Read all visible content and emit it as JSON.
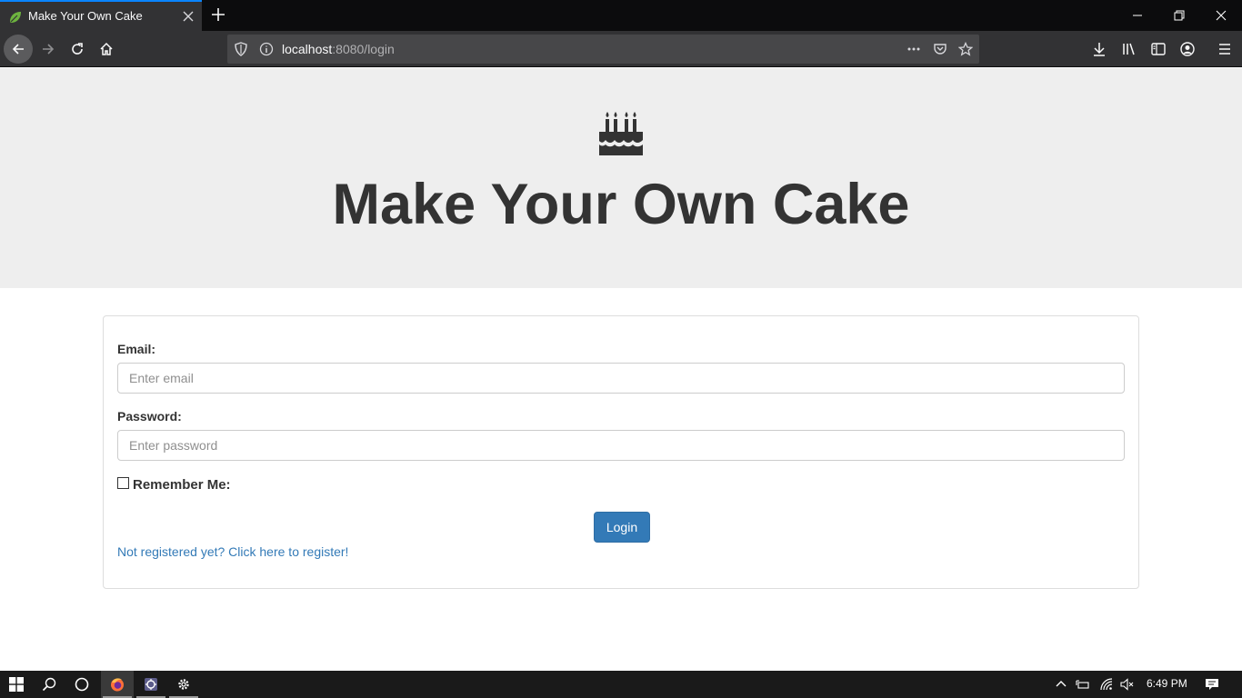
{
  "browser": {
    "tab_title": "Make Your Own Cake",
    "url_host": "localhost",
    "url_rest": ":8080/login"
  },
  "page": {
    "title": "Make Your Own Cake",
    "icon": "birthday-cake-icon"
  },
  "form": {
    "email_label": "Email:",
    "email_placeholder": "Enter email",
    "email_value": "",
    "password_label": "Password:",
    "password_placeholder": "Enter password",
    "password_value": "",
    "remember_label": "Remember Me:",
    "remember_checked": false,
    "login_label": "Login",
    "register_link": "Not registered yet? Click here to register!"
  },
  "taskbar": {
    "time": "6:49 PM"
  },
  "colors": {
    "accent": "#337ab7",
    "jumbotron_bg": "#eeeeee",
    "chrome_dark": "#323234",
    "tab_highlight": "#0a84ff"
  }
}
